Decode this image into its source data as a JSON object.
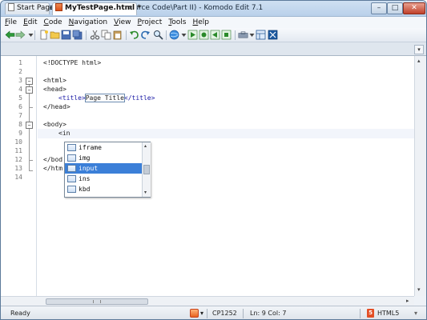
{
  "window": {
    "title": "MyTestPage.html* (C:\\0280 - Source Code\\Part II) - Komodo Edit 7.1",
    "controls": {
      "minimize": "–",
      "maximize": "□",
      "close": "✕"
    }
  },
  "menu": {
    "items": [
      {
        "key": "F",
        "rest": "ile"
      },
      {
        "key": "E",
        "rest": "dit"
      },
      {
        "key": "C",
        "rest": "ode"
      },
      {
        "key": "N",
        "rest": "avigation"
      },
      {
        "key": "V",
        "rest": "iew"
      },
      {
        "key": "P",
        "rest": "roject"
      },
      {
        "key": "T",
        "rest": "ools"
      },
      {
        "key": "H",
        "rest": "elp"
      }
    ]
  },
  "toolbar": {
    "icons": [
      "back-arrow-icon",
      "forward-arrow-icon",
      "new-file-icon",
      "open-folder-icon",
      "save-icon",
      "cut-icon",
      "copy-icon",
      "paste-icon",
      "undo-icon",
      "redo-icon",
      "find-icon",
      "browser-preview-icon",
      "run-icon",
      "macro-record-icon",
      "macro-play-icon",
      "macro-stop-icon",
      "toolbox-icon",
      "panes-icon",
      "komodo-icon"
    ]
  },
  "tabs": {
    "start": {
      "label": "Start Page"
    },
    "active": {
      "label": "MyTestPage.html *",
      "close": "✕"
    },
    "dropdown": "▾"
  },
  "editor": {
    "line_numbers": [
      "1",
      "2",
      "3",
      "4",
      "5",
      "6",
      "7",
      "8",
      "9",
      "10",
      "11",
      "12",
      "13",
      "14"
    ],
    "fold_markers": "–",
    "lines": {
      "l1": "<!DOCTYPE html>",
      "l3": "<html>",
      "l4": "<head>",
      "l5_open": "<title>",
      "l5_text": "Page Title",
      "l5_close": "</title>",
      "l6": "</head>",
      "l8": "<body>",
      "l9_typed": "<in",
      "l12_visible": "</bod",
      "l13_visible": "</htm"
    }
  },
  "autocomplete": {
    "items": [
      {
        "label": "iframe",
        "selected": false
      },
      {
        "label": "img",
        "selected": false
      },
      {
        "label": "input",
        "selected": true
      },
      {
        "label": "ins",
        "selected": false
      },
      {
        "label": "kbd",
        "selected": false
      }
    ],
    "scroll_up": "▴",
    "scroll_down": "▾"
  },
  "statusbar": {
    "status": "Ready",
    "encoding": "CP1252",
    "position": "Ln: 9 Col: 7",
    "language": "HTML5",
    "language_badge": "5",
    "dropdown": "▾"
  },
  "colors": {
    "selection": "#3b7fd8",
    "tag": "#1a1aa6",
    "error": "#c0101a"
  }
}
